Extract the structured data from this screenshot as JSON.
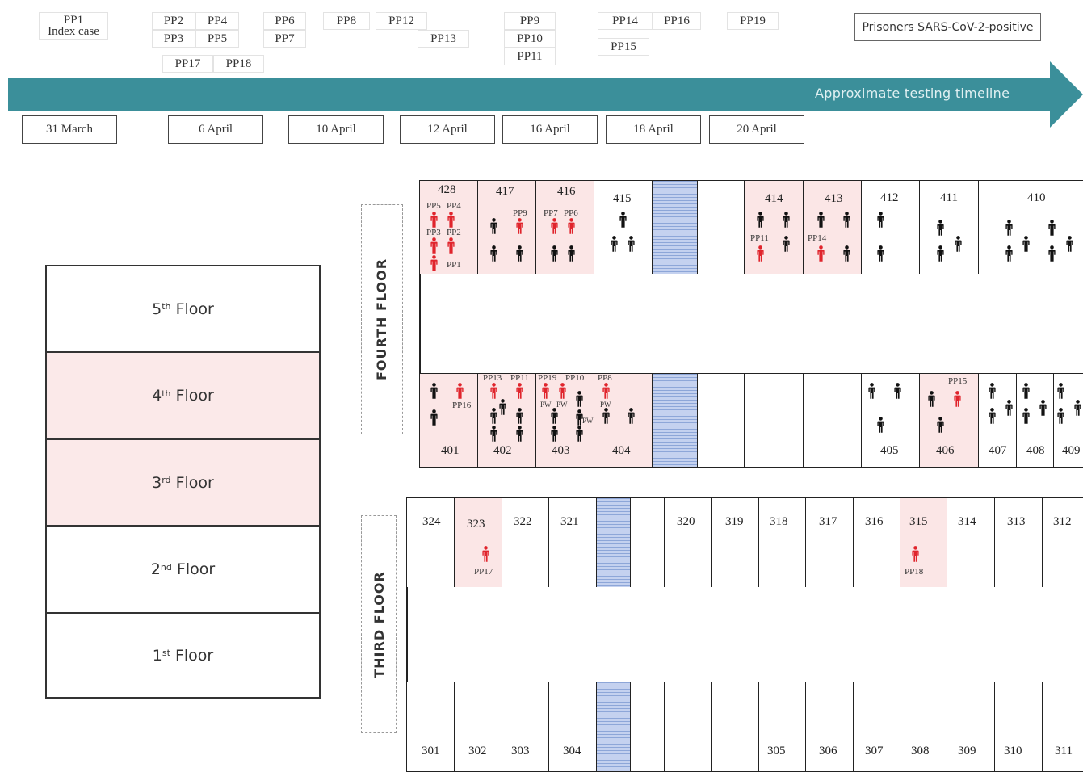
{
  "timeline": {
    "top_labels": [
      "PP1",
      "Index case",
      "PP2",
      "PP4",
      "PP3",
      "PP5",
      "PP17",
      "PP18",
      "PP6",
      "PP7",
      "PP8",
      "PP12",
      "PP13",
      "PP9",
      "PP10",
      "PP11",
      "PP14",
      "PP16",
      "PP15",
      "PP19"
    ],
    "legend": "Prisoners SARS-CoV-2-positive",
    "arrow_label": "Approximate testing timeline",
    "arrow_color": "#3b8f9a",
    "dates": [
      "31 March",
      "6 April",
      "10 April",
      "12 April",
      "16 April",
      "18 April",
      "20 April"
    ]
  },
  "floors": {
    "ordinals": [
      "5",
      "4",
      "3",
      "2",
      "1"
    ],
    "suffixes": [
      "th",
      "th",
      "rd",
      "nd",
      "st"
    ],
    "word": "Floor",
    "infected": [
      false,
      true,
      true,
      false,
      false
    ]
  },
  "fourth_floor": {
    "label": "FOURTH FLOOR",
    "top_cells": [
      "428",
      "417",
      "416",
      "415",
      "414",
      "413",
      "412",
      "411",
      "410"
    ],
    "bottom_cells": [
      "401",
      "402",
      "403",
      "404",
      "405",
      "406",
      "407",
      "408",
      "409"
    ],
    "tags": [
      "PP5",
      "PP4",
      "PP3",
      "PP2",
      "PP1",
      "PP9",
      "PP7",
      "PP6",
      "PP11",
      "PP14",
      "PP16",
      "PP13",
      "PP11",
      "PP19",
      "PP10",
      "PP8",
      "PP15",
      "PW",
      "PW",
      "PW",
      "PW"
    ]
  },
  "third_floor": {
    "label": "THIRD FLOOR",
    "top_cells": [
      "324",
      "323",
      "322",
      "321",
      "320",
      "319",
      "318",
      "317",
      "316",
      "315",
      "314",
      "313",
      "312"
    ],
    "bottom_cells": [
      "301",
      "302",
      "303",
      "304",
      "305",
      "306",
      "307",
      "308",
      "309",
      "310",
      "311"
    ],
    "tags": [
      "PP17",
      "PP18"
    ]
  },
  "colors": {
    "positive": "#e0242c",
    "negative": "#111111",
    "infected_cell": "#fbe6e6"
  }
}
